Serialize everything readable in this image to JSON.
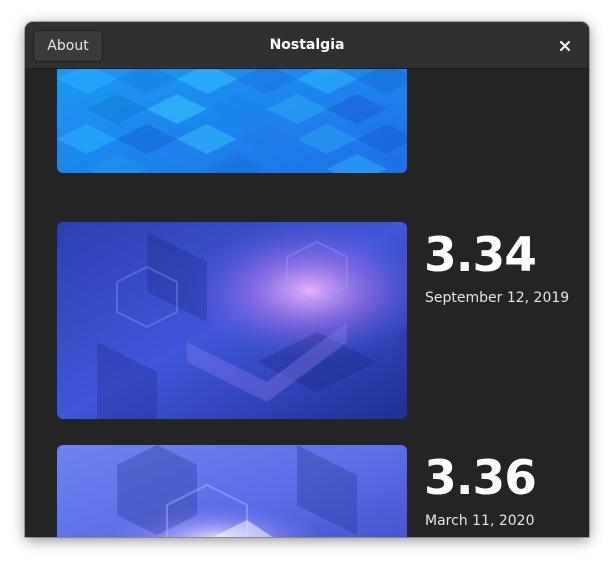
{
  "window": {
    "title": "Nostalgia"
  },
  "header": {
    "about_label": "About",
    "close_icon": "close-icon"
  },
  "releases": [
    {
      "version": "",
      "date": ""
    },
    {
      "version": "3.34",
      "date": "September 12, 2019"
    },
    {
      "version": "3.36",
      "date": "March 11, 2020"
    }
  ],
  "colors": {
    "window_bg": "#242424",
    "headerbar_bg": "#303030",
    "text": "#ffffff"
  }
}
